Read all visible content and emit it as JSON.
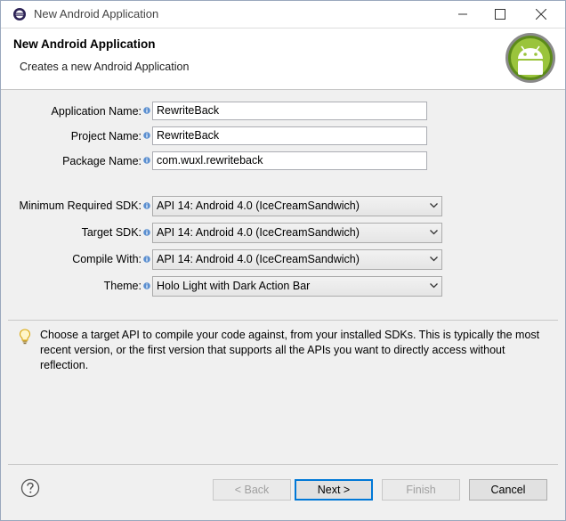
{
  "window": {
    "title": "New Android Application"
  },
  "header": {
    "title": "New Android Application",
    "subtitle": "Creates a new Android Application"
  },
  "form": {
    "app_name_label": "Application Name:",
    "app_name_value": "RewriteBack",
    "project_name_label": "Project Name:",
    "project_name_value": "RewriteBack",
    "package_name_label": "Package Name:",
    "package_name_value": "com.wuxl.rewriteback",
    "min_sdk_label": "Minimum Required SDK:",
    "min_sdk_value": "API 14: Android 4.0 (IceCreamSandwich)",
    "target_sdk_label": "Target SDK:",
    "target_sdk_value": "API 14: Android 4.0 (IceCreamSandwich)",
    "compile_with_label": "Compile With:",
    "compile_with_value": "API 14: Android 4.0 (IceCreamSandwich)",
    "theme_label": "Theme:",
    "theme_value": "Holo Light with Dark Action Bar"
  },
  "hint": "Choose a target API to compile your code against, from your installed SDKs. This is typically the most recent version, or the first version that supports all the APIs you want to directly access without reflection.",
  "buttons": {
    "back": "< Back",
    "next": "Next >",
    "finish": "Finish",
    "cancel": "Cancel"
  },
  "icons": {
    "app": "eclipse-icon",
    "logo": "android-logo",
    "info": "info-icon",
    "hint": "lightbulb-icon",
    "help": "help-icon"
  }
}
